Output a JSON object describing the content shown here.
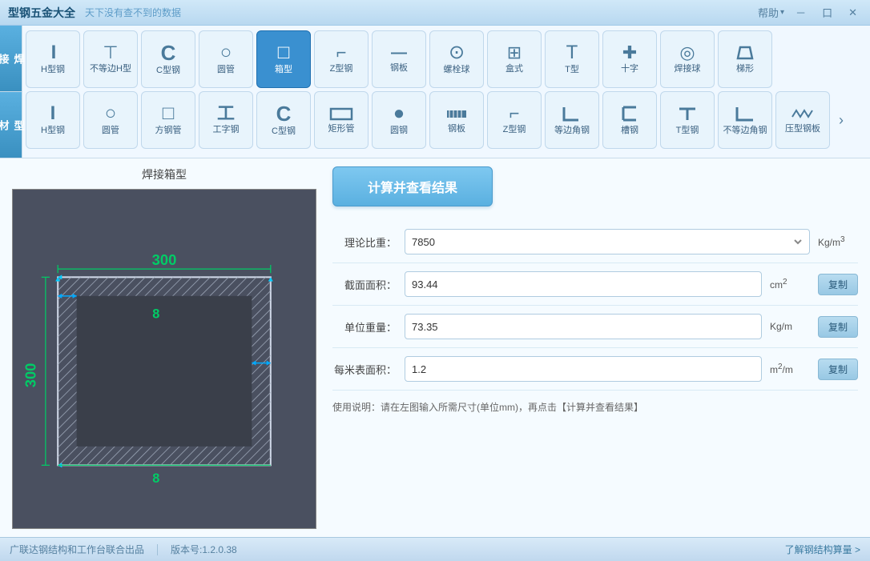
{
  "titlebar": {
    "title": "型钢五金大全",
    "subtitle": "天下没有查不到的数据",
    "help": "帮助",
    "minimize": "－",
    "restore": "口",
    "close": "✕"
  },
  "categories": [
    {
      "id": "weld",
      "label": "焊\n接"
    },
    {
      "id": "material",
      "label": "型\n材"
    }
  ],
  "weld_tools": [
    {
      "id": "h-steel",
      "label": "H型钢",
      "icon": "I"
    },
    {
      "id": "unequal-h",
      "label": "不等边H型",
      "icon": "T"
    },
    {
      "id": "c-steel",
      "label": "C型钢",
      "icon": "C"
    },
    {
      "id": "round-pipe",
      "label": "圆管",
      "icon": "○"
    },
    {
      "id": "box",
      "label": "箱型",
      "icon": "□",
      "active": true
    },
    {
      "id": "z-steel",
      "label": "Z型钢",
      "icon": "Z"
    },
    {
      "id": "steel-plate",
      "label": "钢板",
      "icon": "—"
    },
    {
      "id": "bolt-ball",
      "label": "螺栓球",
      "icon": "⊙"
    },
    {
      "id": "box-style",
      "label": "盒式",
      "icon": "⊞"
    },
    {
      "id": "t-steel",
      "label": "T型",
      "icon": "T"
    },
    {
      "id": "cross",
      "label": "十字",
      "icon": "✚"
    },
    {
      "id": "weld-ball",
      "label": "焊接球",
      "icon": "◎"
    },
    {
      "id": "trapezoid",
      "label": "梯形",
      "icon": "⌂"
    }
  ],
  "material_tools": [
    {
      "id": "m-h-steel",
      "label": "H型钢",
      "icon": "I"
    },
    {
      "id": "m-round-pipe",
      "label": "圆管",
      "icon": "○"
    },
    {
      "id": "m-square-pipe",
      "label": "方钢管",
      "icon": "□"
    },
    {
      "id": "m-i-beam",
      "label": "工字钢",
      "icon": "工"
    },
    {
      "id": "m-c-steel",
      "label": "C型钢",
      "icon": "C"
    },
    {
      "id": "m-rect-pipe",
      "label": "矩形管",
      "icon": "▭"
    },
    {
      "id": "m-round-steel",
      "label": "圆钢",
      "icon": "●"
    },
    {
      "id": "m-plate",
      "label": "钢板",
      "icon": "░"
    },
    {
      "id": "m-z-steel",
      "label": "Z型钢",
      "icon": "Z"
    },
    {
      "id": "m-angle-equal",
      "label": "等边角钢",
      "icon": "L"
    },
    {
      "id": "m-channel",
      "label": "槽钢",
      "icon": "U"
    },
    {
      "id": "m-t-steel",
      "label": "T型钢",
      "icon": "T"
    },
    {
      "id": "m-angle-unequal",
      "label": "不等边角钢",
      "icon": "L"
    },
    {
      "id": "m-press-plate",
      "label": "压型钢板",
      "icon": "≋"
    }
  ],
  "diagram": {
    "title": "焊接箱型",
    "dim_top": "300",
    "dim_left": "300",
    "dim_wall": "8",
    "dim_wall2": "8"
  },
  "form": {
    "calc_button": "计算并查看结果",
    "density_label": "理论比重：",
    "density_value": "7850",
    "density_unit": "Kg/m³",
    "area_label": "截面面积：",
    "area_value": "93.44",
    "area_unit": "cm²",
    "area_copy": "复制",
    "weight_label": "单位重量：",
    "weight_value": "73.35",
    "weight_unit": "Kg/m",
    "weight_copy": "复制",
    "surface_label": "每米表面积：",
    "surface_value": "1.2",
    "surface_unit": "m²/m",
    "surface_copy": "复制",
    "usage_note": "使用说明：请在左图输入所需尺寸(单位mm)，再点击【计算并查看结果】"
  },
  "statusbar": {
    "company": "广联达钢结构和工作台联合出品",
    "version": "版本号:1.2.0.38",
    "link": "了解钢结构算量 >"
  }
}
